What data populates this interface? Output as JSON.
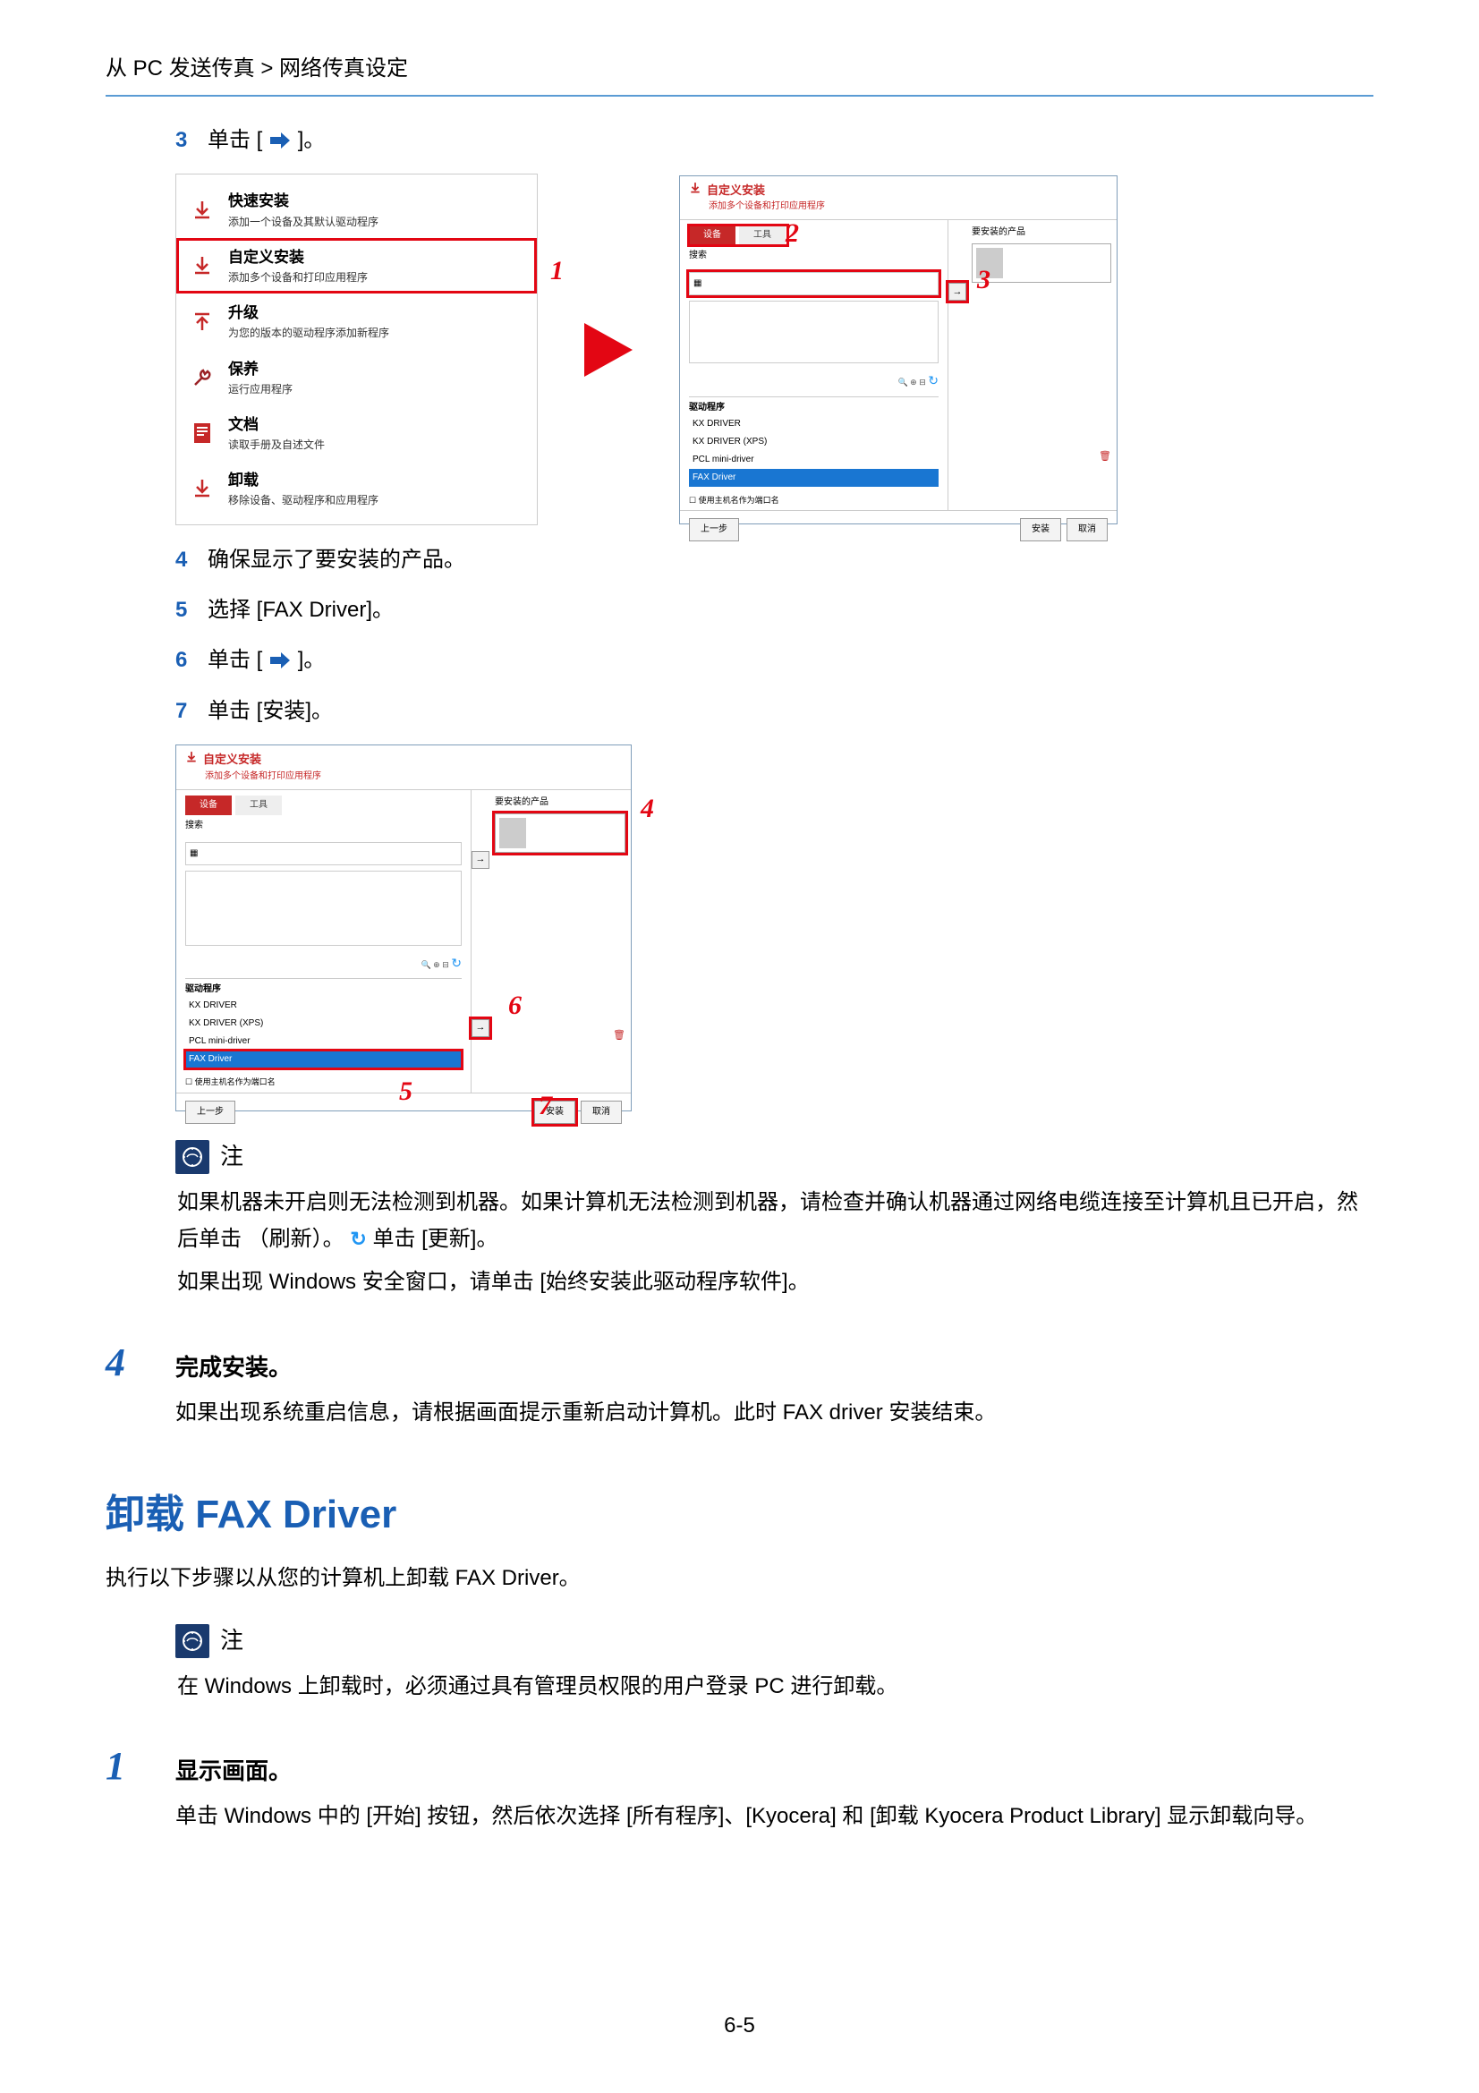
{
  "header": {
    "breadcrumb": "从 PC 发送传真 > 网络传真设定"
  },
  "steps": {
    "s3_num": "3",
    "s3_text_a": "单击 [",
    "s3_text_b": "]。",
    "s4_num": "4",
    "s4_text": "确保显示了要安装的产品。",
    "s5_num": "5",
    "s5_text": "选择 [FAX Driver]。",
    "s6_num": "6",
    "s6_text_a": "单击 [",
    "s6_text_b": "]。",
    "s7_num": "7",
    "s7_text": "单击 [安装]。"
  },
  "installer": {
    "quick_t": "快速安装",
    "quick_s": "添加一个设备及其默认驱动程序",
    "custom_t": "自定义安装",
    "custom_s": "添加多个设备和打印应用程序",
    "upgrade_t": "升级",
    "upgrade_s": "为您的版本的驱动程序添加新程序",
    "maint_t": "保养",
    "maint_s": "运行应用程序",
    "doc_t": "文档",
    "doc_s": "读取手册及自述文件",
    "uninst_t": "卸载",
    "uninst_s": "移除设备、驱动程序和应用程序"
  },
  "wizard": {
    "title": "自定义安装",
    "subtitle": "添加多个设备和打印应用程序",
    "tab1": "设备",
    "tab2": "工具",
    "search": "搜索",
    "device_item": "",
    "tool_refresh": "↻",
    "drv_label": "驱动程序",
    "drv1": "KX DRIVER",
    "drv2": "KX DRIVER (XPS)",
    "drv3": "PCL mini-driver",
    "drv4": "FAX Driver",
    "use_snmp": "使用主机名作为端口名",
    "right_title": "要安装的产品",
    "btn_back": "上一步",
    "btn_install": "安装",
    "btn_cancel": "取消"
  },
  "callouts": {
    "c1": "1",
    "c2": "2",
    "c3": "3",
    "c4": "4",
    "c5": "5",
    "c6": "6",
    "c7": "7"
  },
  "note1": {
    "label": "注",
    "p1a": "如果机器未开启则无法检测到机器。如果计算机无法检测到机器，请检查并确认机器通过网络电缆连接至计算机且已开启，然后单击 （刷新）。",
    "p1b": " 单击 [更新]。",
    "p2": "如果出现 Windows 安全窗口，请单击 [始终安装此驱动程序软件]。"
  },
  "major4": {
    "num": "4",
    "title": "完成安装。",
    "body": "如果出现系统重启信息，请根据画面提示重新启动计算机。此时 FAX driver 安装结束。"
  },
  "h2": "卸载 FAX Driver",
  "h2_sub": "执行以下步骤以从您的计算机上卸载 FAX Driver。",
  "note2": {
    "label": "注",
    "body": "在 Windows 上卸载时，必须通过具有管理员权限的用户登录 PC 进行卸载。"
  },
  "major1": {
    "num": "1",
    "title": "显示画面。",
    "body": "单击 Windows 中的 [开始] 按钮，然后依次选择 [所有程序]、[Kyocera] 和 [卸载  Kyocera Product Library] 显示卸载向导。"
  },
  "footer": "6-5"
}
